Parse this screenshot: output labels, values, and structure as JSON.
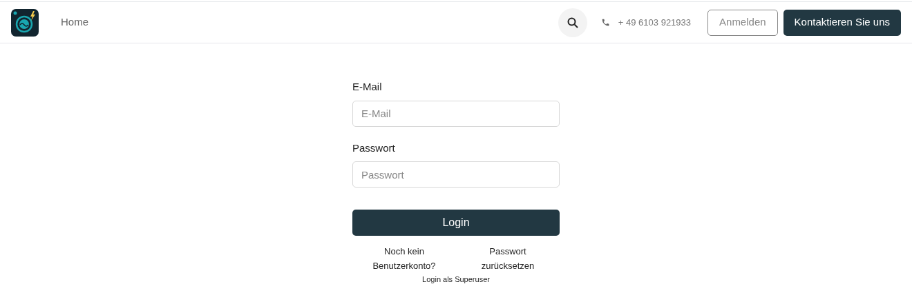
{
  "nav": {
    "items": [
      {
        "label": "Home"
      }
    ],
    "phone": "+ 49 6103 921933",
    "buttons": [
      {
        "label": "Anmelden",
        "kind": "outline"
      },
      {
        "label": "Kontaktieren Sie uns",
        "kind": "solid"
      }
    ]
  },
  "form": {
    "fields": [
      {
        "label": "E-Mail",
        "placeholder": "E-Mail"
      },
      {
        "label": "Passwort",
        "placeholder": "Passwort"
      }
    ],
    "submit": "Login",
    "links": [
      "Noch kein Benutzerkonto?",
      "Passwort zurücksetzen"
    ],
    "superuser": "Login als Superuser"
  }
}
